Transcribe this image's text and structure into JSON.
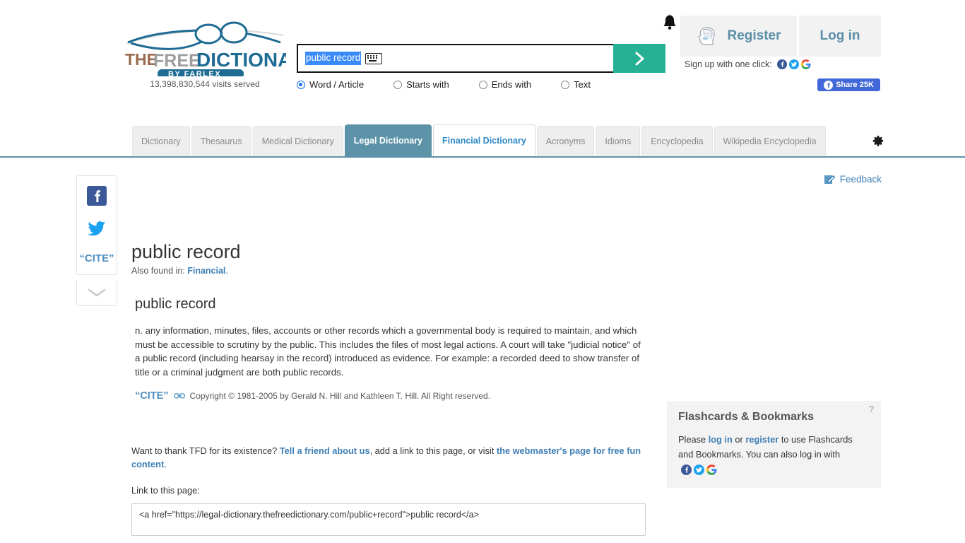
{
  "site": {
    "logo_the": "THE",
    "logo_free": "FREE",
    "logo_dictionary": "DICTIONARY",
    "logo_byline": "BY FARLEX",
    "visits": "13,398,830,544 visits served"
  },
  "search": {
    "value": "public record",
    "keyboard_icon": "keyboard-icon",
    "submit_icon": "chevron-right-icon",
    "accent_color": "#26b196",
    "options": [
      {
        "label": "Word / Article",
        "selected": true
      },
      {
        "label": "Starts with",
        "selected": false
      },
      {
        "label": "Ends with",
        "selected": false
      },
      {
        "label": "Text",
        "selected": false
      }
    ]
  },
  "account": {
    "bell_icon": "notification-bell-icon",
    "avatar_icon": "brain-head-avatar-icon",
    "register_label": "Register",
    "login_label": "Log in",
    "signup_label": "Sign up with one click:",
    "signup_icons": [
      "facebook-icon",
      "twitter-icon",
      "google-icon"
    ],
    "share_label": "Share 25K",
    "share_icon": "facebook-icon",
    "share_color": "#4267d8"
  },
  "tabs": [
    {
      "label": "Dictionary",
      "state": "normal"
    },
    {
      "label": "Thesaurus",
      "state": "normal"
    },
    {
      "label": "Medical Dictionary",
      "state": "normal"
    },
    {
      "label": "Legal Dictionary",
      "state": "active"
    },
    {
      "label": "Financial Dictionary",
      "state": "hover"
    },
    {
      "label": "Acronyms",
      "state": "normal"
    },
    {
      "label": "Idioms",
      "state": "normal"
    },
    {
      "label": "Encyclopedia",
      "state": "normal"
    },
    {
      "label": "Wikipedia Encyclopedia",
      "state": "normal"
    }
  ],
  "tab_accent": "#5c93a8",
  "settings_icon": "gear-icon",
  "rail": {
    "facebook_icon": "facebook-icon",
    "twitter_icon": "twitter-icon",
    "cite_label": "“CITE”",
    "toggle_icon": "chevron-down-icon"
  },
  "feedback": {
    "label": "Feedback",
    "icon": "pencil-edit-icon"
  },
  "entry": {
    "title": "public record",
    "also_found_prefix": "Also found in: ",
    "also_found_link": "Financial",
    "also_found_suffix": ".",
    "section_heading": "public record",
    "definition": "n. any information, minutes, files, accounts or other records which a governmental body is required to maintain, and which must be accessible to scrutiny by the public. This includes the files of most legal actions. A court will take \"judicial notice\" of a public record (including hearsay in the record) introduced as evidence. For example: a recorded deed to show transfer of title or a criminal judgment are both public records.",
    "cite_label": "“CITE”",
    "cite_link_icon": "link-chain-icon",
    "copyright": "Copyright © 1981-2005 by Gerald N. Hill and Kathleen T. Hill. All Right reserved."
  },
  "thanks": {
    "part1": "Want to thank TFD for its existence? ",
    "link1": "Tell a friend about us",
    "part2": ", add a link to this page, or visit ",
    "link2": "the webmaster's page for free fun content",
    "part3": "."
  },
  "link_section": {
    "label": "Link to this page:",
    "value": "<a href=\"https://legal-dictionary.thefreedictionary.com/public+record\">public record</a>"
  },
  "flashcards": {
    "help_icon": "?",
    "title": "Flashcards & Bookmarks",
    "text_part1": "Please ",
    "login_link": "log in",
    "text_or": " or ",
    "register_link": "register",
    "text_part2": " to use Flashcards and Bookmarks. You can also log in with",
    "social_icons": [
      "facebook-icon",
      "twitter-icon",
      "google-icon"
    ]
  }
}
